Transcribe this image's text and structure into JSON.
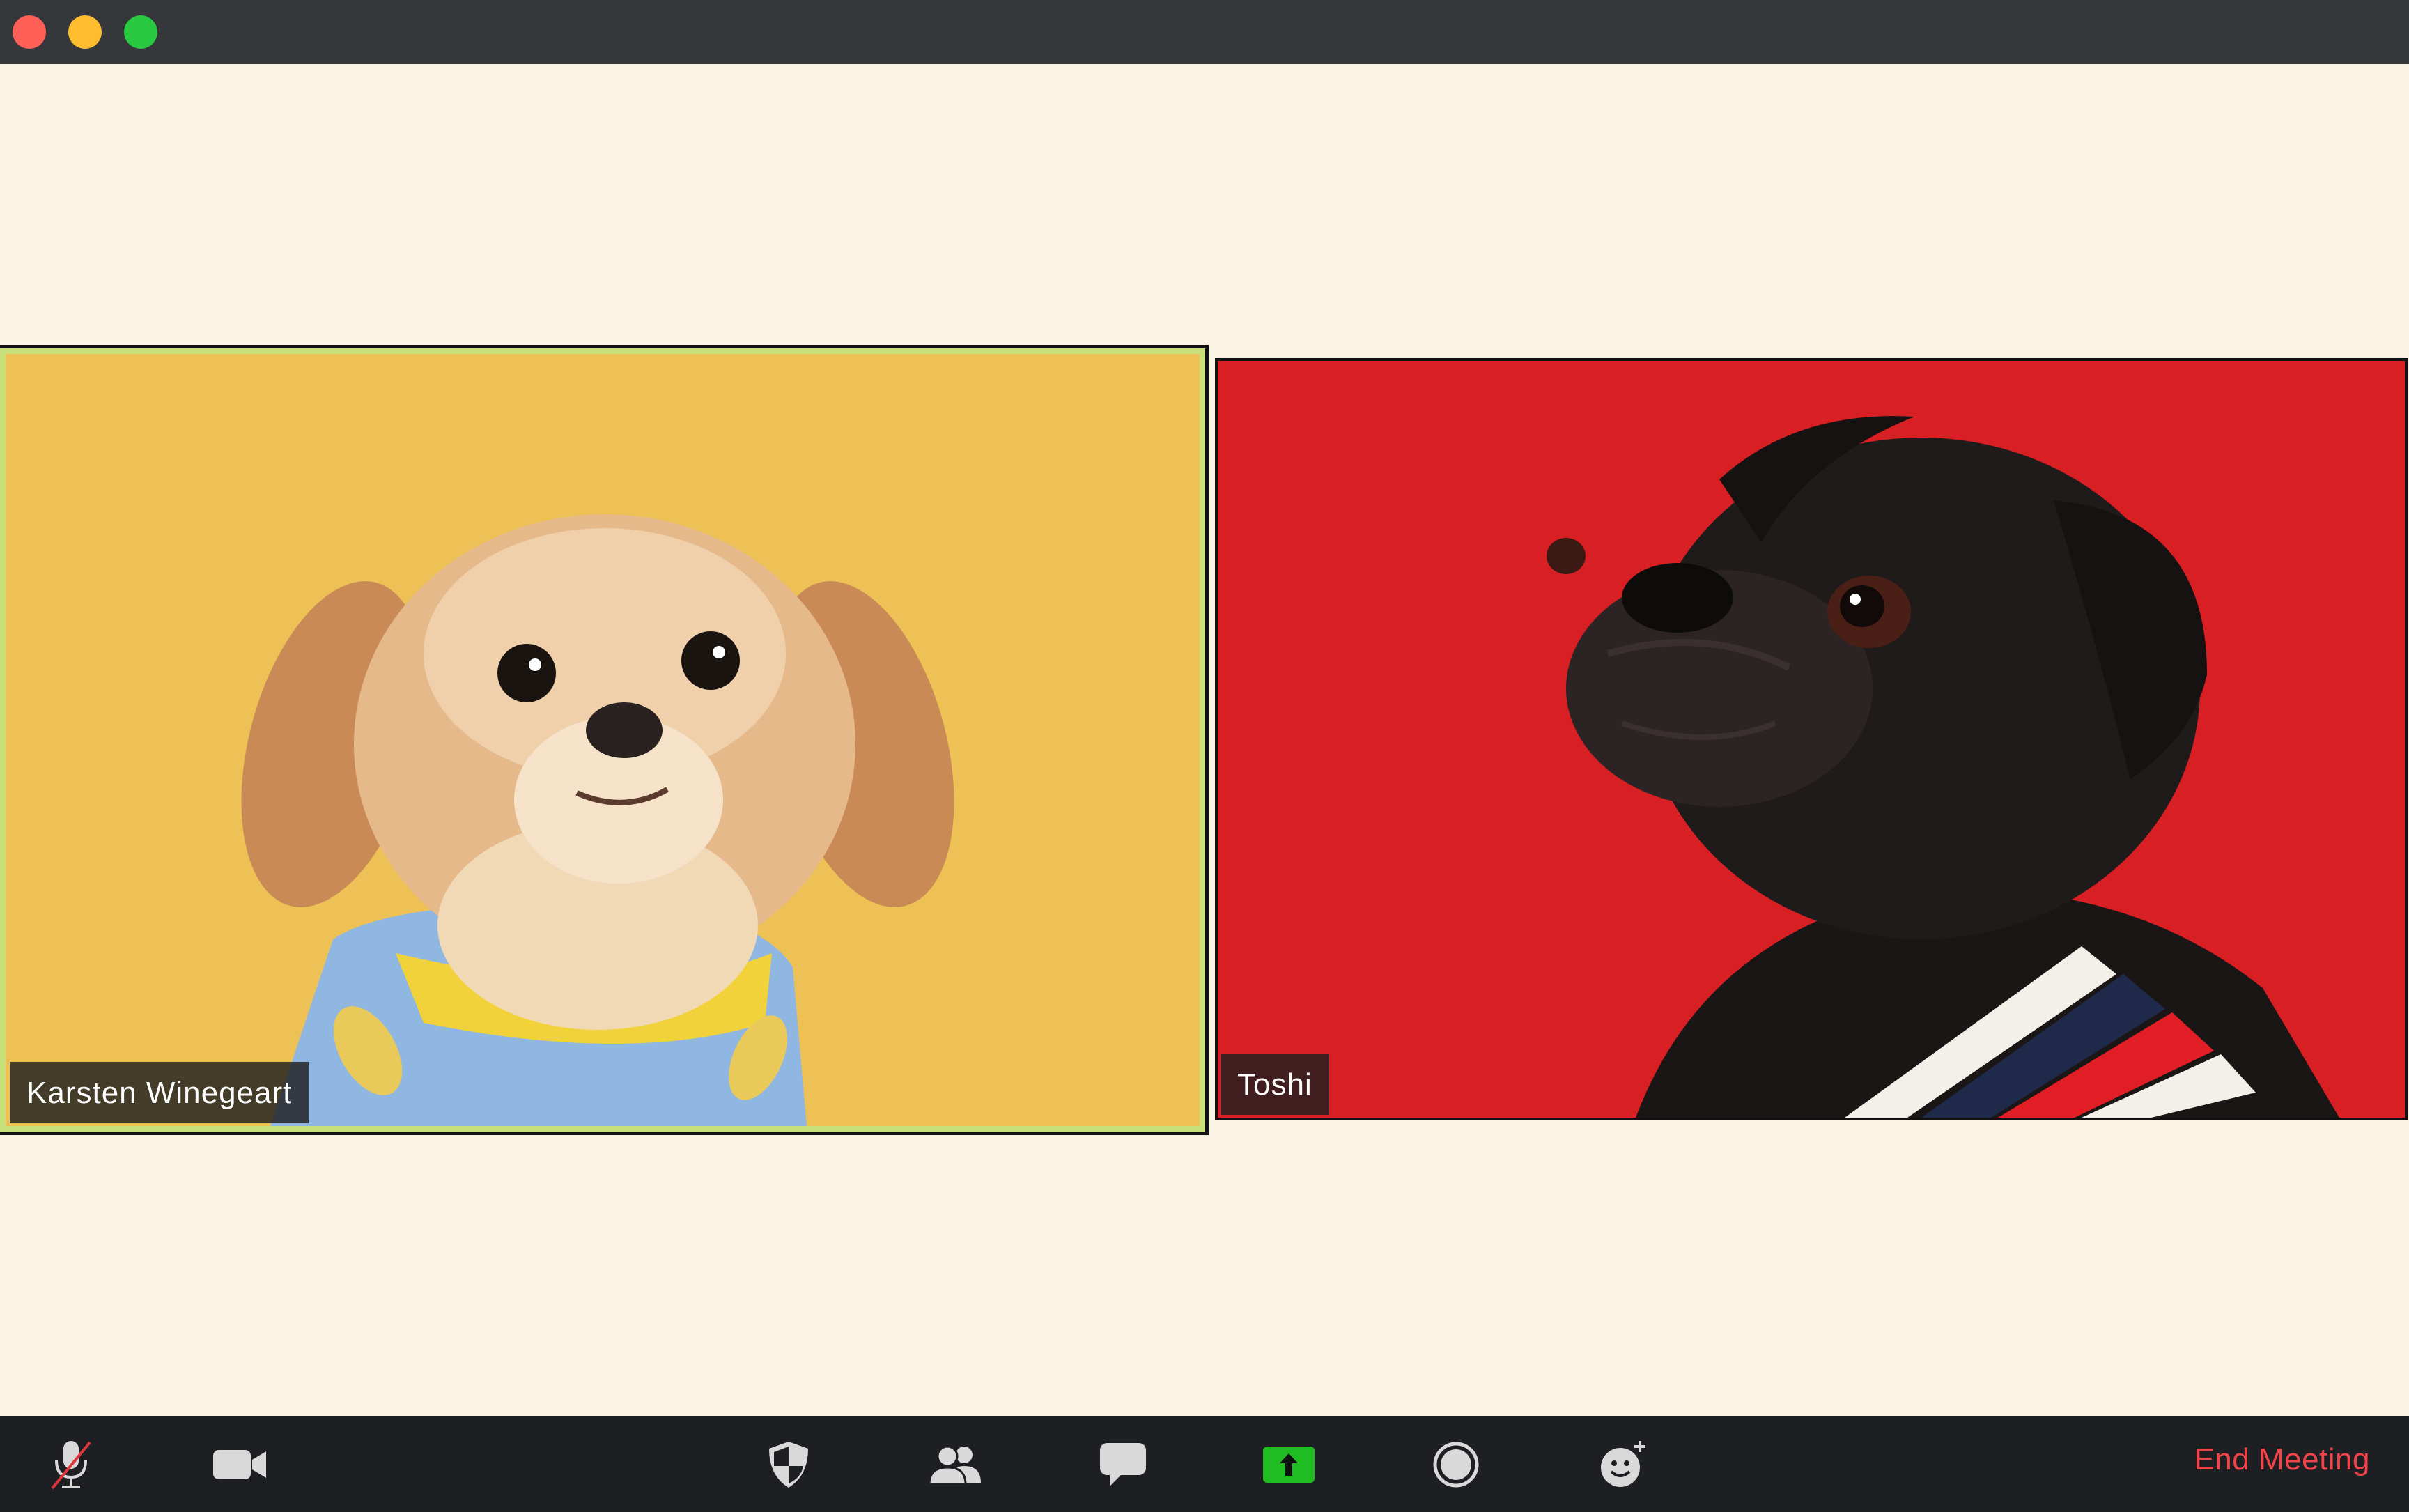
{
  "window": {
    "controls": [
      "close",
      "minimize",
      "maximize"
    ]
  },
  "participants": [
    {
      "name": "Karsten Winegeart",
      "active_speaker": true,
      "background_color": "#eec156",
      "highlight_color": "#c8e07a"
    },
    {
      "name": "Toshi",
      "active_speaker": false,
      "background_color": "#d71f24"
    }
  ],
  "toolbar": {
    "buttons": [
      {
        "id": "mute",
        "icon": "microphone-muted-icon"
      },
      {
        "id": "video",
        "icon": "video-camera-icon"
      },
      {
        "id": "security",
        "icon": "shield-icon"
      },
      {
        "id": "participants",
        "icon": "people-icon"
      },
      {
        "id": "chat",
        "icon": "chat-bubble-icon"
      },
      {
        "id": "share-screen",
        "icon": "share-screen-icon",
        "accent": "#1fbc22"
      },
      {
        "id": "record",
        "icon": "record-icon"
      },
      {
        "id": "reactions",
        "icon": "reaction-smile-icon"
      }
    ],
    "end_meeting_label": "End Meeting",
    "end_color": "#f0434a"
  }
}
